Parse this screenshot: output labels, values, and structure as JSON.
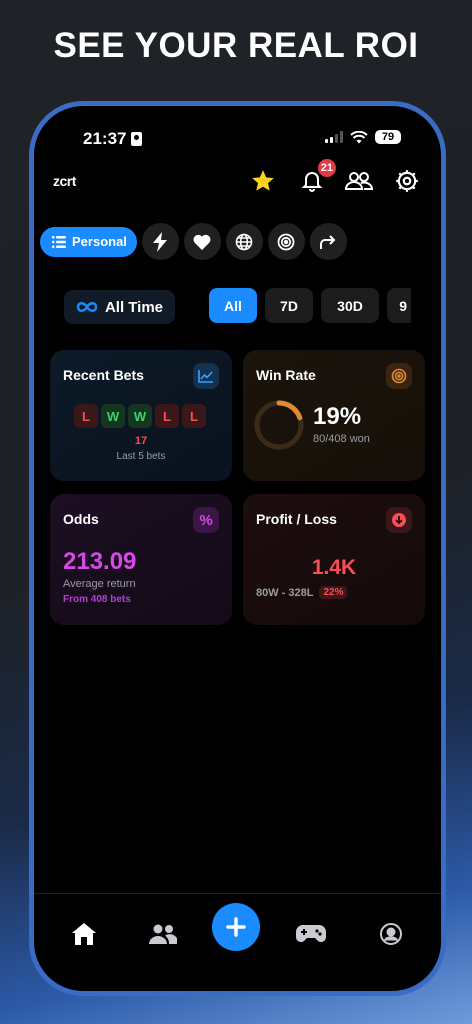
{
  "headline": "SEE YOUR REAL ROI",
  "status": {
    "time": "21:37",
    "battery": "79"
  },
  "header": {
    "logo": "zcrt",
    "notifications_count": "21"
  },
  "filters": {
    "personal_label": "Personal",
    "icons": [
      "lightning-icon",
      "heart-icon",
      "globe-icon",
      "target-icon",
      "share-arrow-icon"
    ]
  },
  "time_range": {
    "all_time_label": "All Time",
    "segments": [
      "All",
      "7D",
      "30D",
      "9"
    ]
  },
  "cards": {
    "recent": {
      "title": "Recent Bets",
      "results": [
        "L",
        "W",
        "W",
        "L",
        "L"
      ],
      "streak": "17",
      "caption": "Last 5 bets"
    },
    "win_rate": {
      "title": "Win Rate",
      "value": "19%",
      "sub": "80/408 won",
      "fraction": 0.196
    },
    "odds": {
      "title": "Odds",
      "icon_label": "%",
      "value": "213.09",
      "sub": "Average return",
      "sub2": "From 408 bets"
    },
    "profit": {
      "title": "Profit / Loss",
      "value": "1.4K",
      "record": "80W - 328L",
      "pct": "22%"
    }
  },
  "colors": {
    "accent": "#1a8cff",
    "loss": "#ff4b55",
    "win": "#3bd46a",
    "odds": "#d54ae6",
    "win_rate": "#e08a35",
    "star": "#ffd21f"
  },
  "tabbar": {
    "items": [
      "home-icon",
      "users-icon",
      "add-icon",
      "gamepad-icon",
      "profile-icon"
    ]
  }
}
